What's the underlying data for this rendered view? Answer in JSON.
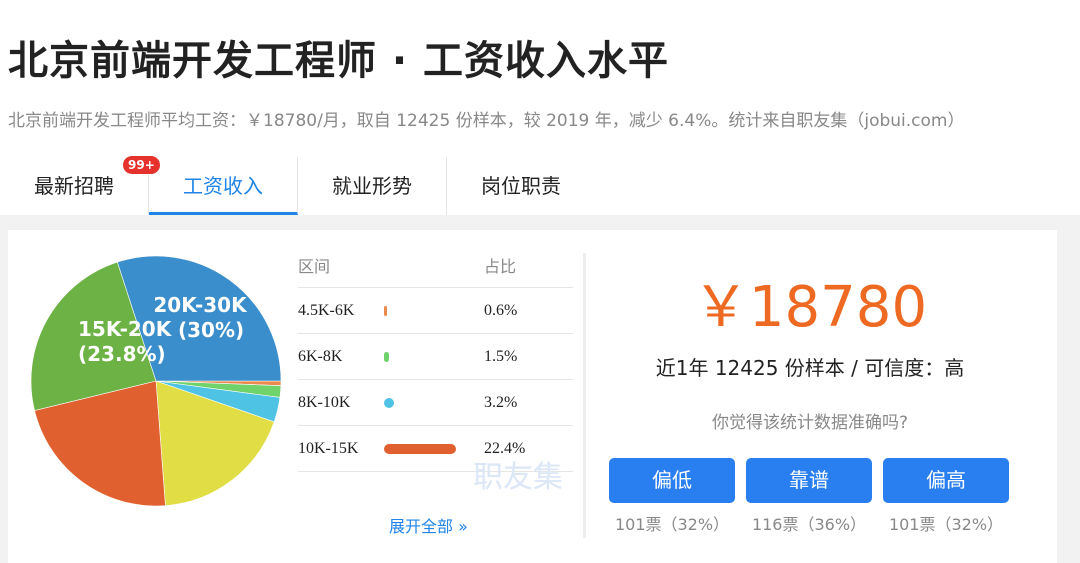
{
  "header": {
    "title": "北京前端开发工程师 · 工资收入水平",
    "subtitle": "北京前端开发工程师平均工资：￥18780/月，取自 12425 份样本，较 2019 年，减少 6.4%。统计来自职友集（jobui.com）"
  },
  "tabs": [
    {
      "label": "最新招聘",
      "badge": "99+"
    },
    {
      "label": "工资收入",
      "active": true
    },
    {
      "label": "就业形势"
    },
    {
      "label": "岗位职责"
    }
  ],
  "table": {
    "headers": [
      "区间",
      "占比"
    ],
    "rows": [
      {
        "range": "4.5K-6K",
        "percent": "0.6%",
        "value": 0.6,
        "color": "#ea8a4f"
      },
      {
        "range": "6K-8K",
        "percent": "1.5%",
        "value": 1.5,
        "color": "#6fd26a"
      },
      {
        "range": "8K-10K",
        "percent": "3.2%",
        "value": 3.2,
        "color": "#4fc3e3"
      },
      {
        "range": "10K-15K",
        "percent": "22.4%",
        "value": 22.4,
        "color": "#e0612f"
      }
    ],
    "more": "展开全部 »",
    "watermark": "职友集"
  },
  "chart_data": {
    "type": "pie",
    "start": "3 o'clock, clockwise",
    "slices": [
      {
        "label": "4.5K-6K",
        "value": 0.6,
        "color": "#ea8a4f"
      },
      {
        "label": "6K-8K",
        "value": 1.5,
        "color": "#6fd26a"
      },
      {
        "label": "8K-10K",
        "value": 3.2,
        "color": "#4fc3e3"
      },
      {
        "label": "",
        "value": 18.5,
        "color": "#e0dd45"
      },
      {
        "label": "10K-15K",
        "value": 22.4,
        "color": "#e0612f"
      },
      {
        "label": "15K-20K",
        "value": 23.8,
        "color": "#6db244",
        "data_label": [
          "15K-20K",
          "(23.8%)"
        ]
      },
      {
        "label": "20K-30K",
        "value": 30,
        "color": "#3a8ecb",
        "data_label": [
          "20K-30K",
          "(30%)"
        ]
      }
    ]
  },
  "summary": {
    "salary": "￥18780",
    "meta": "近1年 12425 份样本 / 可信度：高",
    "question": "你觉得该统计数据准确吗?"
  },
  "votes": [
    {
      "label": "偏低",
      "count": "101票（32%）"
    },
    {
      "label": "靠谱",
      "count": "116票（36%）"
    },
    {
      "label": "偏高",
      "count": "101票（32%）"
    }
  ]
}
